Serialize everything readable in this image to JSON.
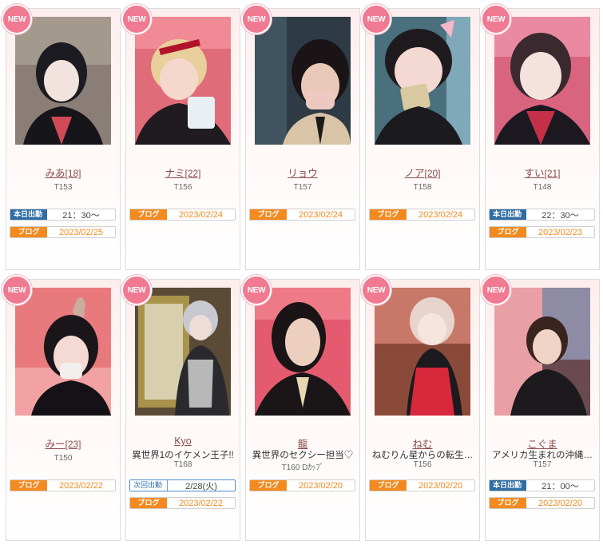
{
  "new_label": "NEW",
  "labels": {
    "today": "本日出勤",
    "blog": "ブログ",
    "next": "次回出勤"
  },
  "casts": [
    {
      "name": "みあ",
      "age": "[18]",
      "height": "T153",
      "shift": "21：30～",
      "blog_date": "2023/02/25"
    },
    {
      "name": "ナミ",
      "age": "[22]",
      "height": "T156",
      "blog_date": "2023/02/24"
    },
    {
      "name": "リョウ",
      "age": "",
      "height": "T157",
      "blog_date": "2023/02/24"
    },
    {
      "name": "ノア",
      "age": "[20]",
      "height": "T158",
      "blog_date": "2023/02/24"
    },
    {
      "name": "すい",
      "age": "[21]",
      "height": "T148",
      "shift": "22：30～",
      "blog_date": "2023/02/23"
    },
    {
      "name": "みー",
      "age": "[23]",
      "height": "T150",
      "blog_date": "2023/02/22"
    },
    {
      "name": "Kyo",
      "age": "",
      "catch": "異世界1のイケメン王子!!",
      "height": "T168",
      "next_shift": "2/28(火)",
      "blog_date": "2023/02/22"
    },
    {
      "name": "龍",
      "age": "",
      "catch": "異世界のセクシー担当♡",
      "height": "T160 Dｶｯﾌﾟ",
      "blog_date": "2023/02/20"
    },
    {
      "name": "ねむ",
      "age": "",
      "catch": "ねむりん星からの転生…",
      "height": "T156",
      "blog_date": "2023/02/20"
    },
    {
      "name": "こぐま",
      "age": "",
      "catch": "アメリカ生まれの沖縄…",
      "height": "T157",
      "shift": "21：00～",
      "blog_date": "2023/02/20"
    }
  ],
  "colors": {
    "accent": "#f07a92",
    "blog": "#f28a1f",
    "today": "#2e6da4",
    "name": "#8b4a4a"
  }
}
